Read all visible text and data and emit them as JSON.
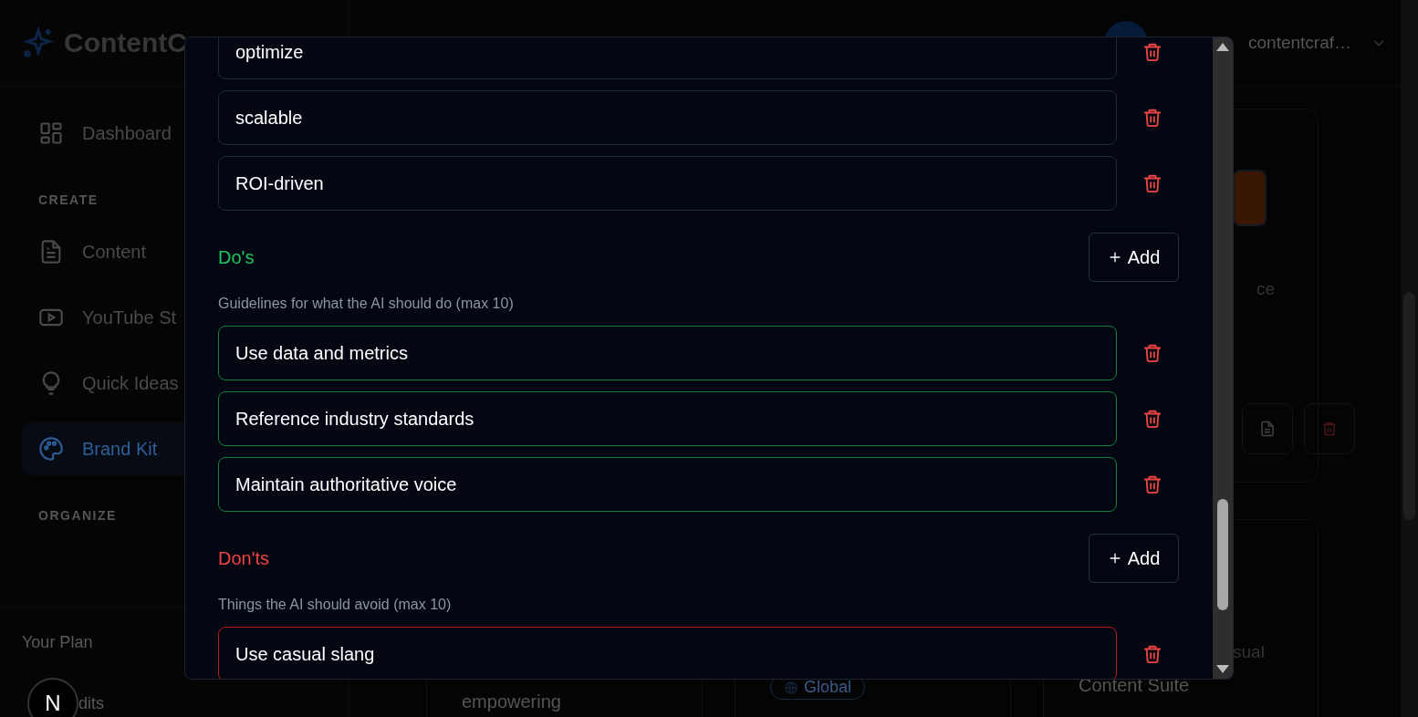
{
  "header": {
    "logo": "ContentC",
    "account": "contentcraf…"
  },
  "sidebar": {
    "items": [
      {
        "kind": "item",
        "label": "Dashboard",
        "selected": false
      },
      {
        "kind": "section",
        "label": "CREATE"
      },
      {
        "kind": "item",
        "label": "Content",
        "selected": false
      },
      {
        "kind": "item",
        "label": "YouTube St",
        "selected": false
      },
      {
        "kind": "item",
        "label": "Quick Ideas",
        "selected": false
      },
      {
        "kind": "item",
        "label": "Brand Kit",
        "selected": true
      },
      {
        "kind": "section",
        "label": "ORGANIZE"
      }
    ],
    "plan": {
      "label": "Your Plan",
      "badge": "N",
      "credits": "dits"
    }
  },
  "background_cards": {
    "columns": [
      {
        "bottom_text": "empowering"
      },
      {
        "tag": "Global"
      },
      {
        "snippet": "ce",
        "bottom_snippet": "sual",
        "bottom_text": "Content Suite"
      }
    ]
  },
  "modal": {
    "sections": [
      {
        "kind": "plain",
        "items": [
          "optimize",
          "scalable",
          "ROI-driven"
        ]
      },
      {
        "kind": "dos",
        "title": "Do's",
        "add_label": "Add",
        "description": "Guidelines for what the AI should do (max 10)",
        "items": [
          "Use data and metrics",
          "Reference industry standards",
          "Maintain authoritative voice"
        ]
      },
      {
        "kind": "donts",
        "title": "Don'ts",
        "add_label": "Add",
        "description": "Things the AI should avoid (max 10)",
        "items": [
          "Use casual slang"
        ]
      }
    ]
  }
}
